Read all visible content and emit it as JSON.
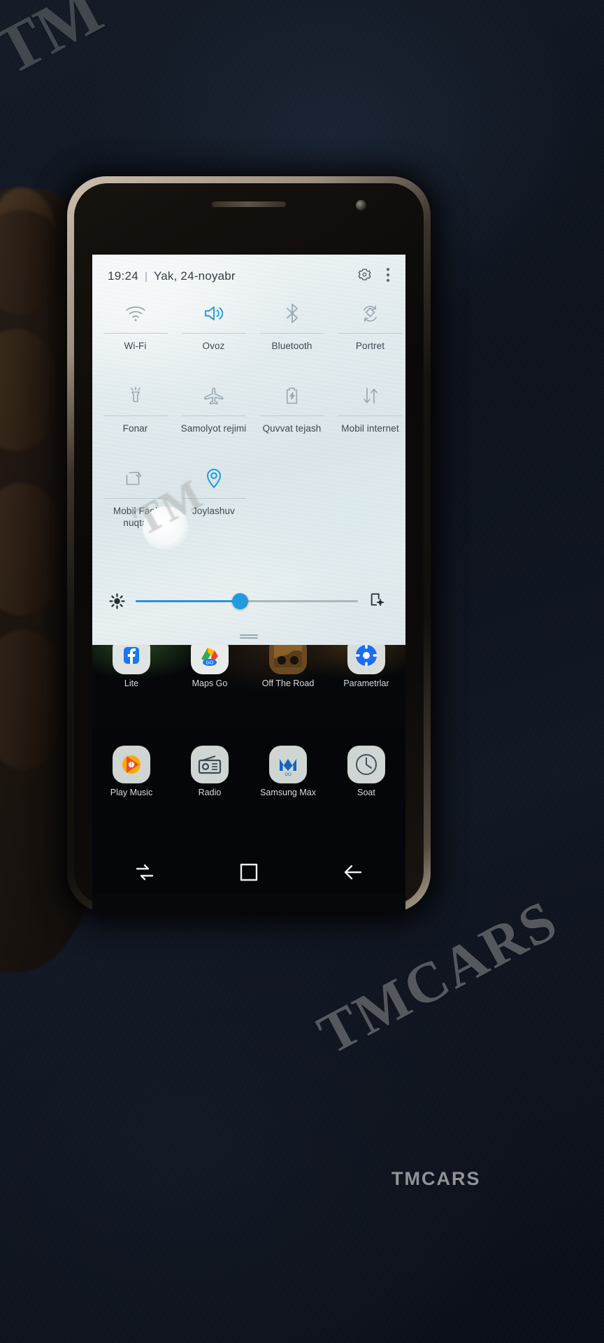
{
  "watermark": {
    "corner": "TM",
    "middle": "TM",
    "big": "TMCARS",
    "footer": "TMCARS"
  },
  "phone": {
    "device_note": "android-phone-in-hand",
    "status_bar": {
      "time": "19:24",
      "separator": "|",
      "date": "Yak, 24-noyabr",
      "settings_icon": "gear-icon",
      "overflow_icon": "three-dots-vertical-icon"
    },
    "quick_settings": {
      "accent_color": "#1f9bde",
      "inactive_color": "#8e9ba4",
      "panel_bg": "#e8eff1",
      "rows": [
        [
          {
            "label": "Wi-Fi",
            "icon": "wifi-icon",
            "state": "off"
          },
          {
            "label": "Ovoz",
            "icon": "sound-speaker-icon",
            "state": "on"
          },
          {
            "label": "Bluetooth",
            "icon": "bluetooth-icon",
            "state": "off"
          },
          {
            "label": "Portret",
            "icon": "auto-rotate-icon",
            "state": "off"
          }
        ],
        [
          {
            "label": "Fonar",
            "icon": "flashlight-icon",
            "state": "off"
          },
          {
            "label": "Samolyot rejimi",
            "icon": "airplane-icon",
            "state": "off"
          },
          {
            "label": "Quvvat tejash",
            "icon": "battery-saver-icon",
            "state": "off"
          },
          {
            "label": "Mobil internet",
            "icon": "mobile-data-arrows-icon",
            "state": "off"
          }
        ],
        [
          {
            "label": "Mobil Faol nuqta",
            "icon": "hotspot-icon",
            "state": "off"
          },
          {
            "label": "Joylashuv",
            "icon": "location-pin-icon",
            "state": "on"
          }
        ]
      ],
      "brightness": {
        "icon": "brightness-sun-icon",
        "settings_icon": "display-settings-icon",
        "value_percent": 47
      },
      "drag_handle": "panel-drag-handle"
    },
    "home_screen": {
      "app_rows": [
        [
          {
            "label": "Lite",
            "icon": "facebook-lite-icon"
          },
          {
            "label": "Maps Go",
            "icon": "google-maps-go-icon"
          },
          {
            "label": "Off The Road",
            "icon": "off-the-road-game-icon"
          },
          {
            "label": "Parametrlar",
            "icon": "settings-app-icon"
          }
        ],
        [
          {
            "label": "Play Music",
            "icon": "google-play-music-icon"
          },
          {
            "label": "Radio",
            "icon": "radio-app-icon"
          },
          {
            "label": "Samsung Max",
            "icon": "samsung-max-icon"
          },
          {
            "label": "Soat",
            "icon": "clock-app-icon"
          }
        ]
      ]
    },
    "navigation_bar": {
      "recents": "recents-icon",
      "home": "home-icon",
      "back": "back-arrow-icon"
    }
  }
}
